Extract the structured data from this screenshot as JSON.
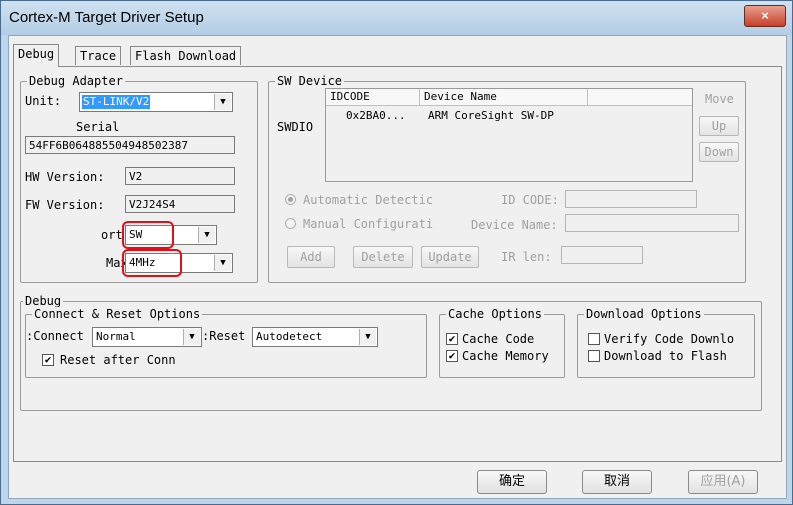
{
  "window": {
    "title": "Cortex-M Target Driver Setup",
    "close_glyph": "×"
  },
  "tabs": [
    {
      "label": "Debug",
      "active": true
    },
    {
      "label": "Trace",
      "active": false
    },
    {
      "label": "Flash Download",
      "active": false
    }
  ],
  "debug_adapter": {
    "title": "Debug Adapter",
    "unit_label": "Unit:",
    "unit_value": "ST-LINK/V2",
    "serial_label": "Serial",
    "serial_value": "54FF6B064885504948502387",
    "hw_label": "HW Version:",
    "hw_value": "V2",
    "fw_label": "FW Version:",
    "fw_value": "V2J24S4",
    "port_label": "ort:",
    "port_value": "SW",
    "max_label": "Max",
    "max_value": "4MHz"
  },
  "sw_device": {
    "title": "SW Device",
    "swdio_label": "SWDIO",
    "columns": [
      "IDCODE",
      "Device Name"
    ],
    "rows": [
      {
        "idcode": "0x2BA0...",
        "device_name": "ARM CoreSight SW-DP"
      }
    ],
    "move_label": "Move",
    "up_label": "Up",
    "down_label": "Down",
    "auto_detect_label": "Automatic Detectic",
    "manual_config_label": "Manual Configurati",
    "id_code_label": "ID CODE:",
    "device_name_label": "Device Name:",
    "ir_len_label": "IR len:",
    "add_label": "Add",
    "delete_label": "Delete",
    "update_label": "Update"
  },
  "debug": {
    "title": "Debug",
    "connect_reset": {
      "title": "Connect & Reset Options",
      "connect_label": "Connect:",
      "connect_value": "Normal",
      "reset_label": "Reset:",
      "reset_value": "Autodetect",
      "reset_after_label": "Reset after Conn",
      "reset_after_checked": true
    },
    "cache": {
      "title": "Cache Options",
      "cache_code_label": "Cache Code",
      "cache_code_checked": true,
      "cache_memory_label": "Cache Memory",
      "cache_memory_checked": true
    },
    "download": {
      "title": "Download Options",
      "verify_label": "Verify Code Downlo",
      "verify_checked": false,
      "download_flash_label": "Download to Flash",
      "download_flash_checked": false
    }
  },
  "footer": {
    "ok_label": "确定",
    "cancel_label": "取消",
    "apply_label": "应用(A)"
  },
  "colors": {
    "highlight": "#e0101a",
    "selection": "#3399ff",
    "close_button": "#c8402a"
  },
  "icons": {
    "check": "✔",
    "dropdown": "▼"
  }
}
